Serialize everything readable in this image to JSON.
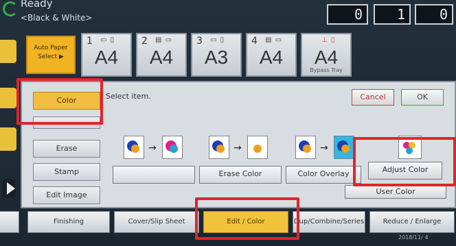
{
  "status": {
    "title": "Ready",
    "mode": "<Black & White>",
    "counter": [
      "0",
      "1",
      "0"
    ]
  },
  "paper": {
    "auto_label": "Auto Paper Select",
    "auto_arrow": "▶",
    "trays": [
      {
        "num": "1",
        "size": "A4"
      },
      {
        "num": "2",
        "size": "A4"
      },
      {
        "num": "3",
        "size": "A3"
      },
      {
        "num": "4",
        "size": "A4"
      },
      {
        "num": "",
        "size": "A4",
        "sub": "Bypass Tray"
      }
    ]
  },
  "dialog": {
    "prompt": "Select item.",
    "cancel": "Cancel",
    "ok": "OK",
    "side_tabs": [
      "Color",
      "",
      "Erase",
      "Stamp",
      "Edit Image"
    ],
    "buttons": {
      "erase_color": "Erase Color",
      "color_overlay": "Color Overlay",
      "adjust_color": "Adjust Color",
      "user_color": "User Color"
    }
  },
  "bottom_tabs": [
    "Finishing",
    "Cover/Slip Sheet",
    "Edit / Color",
    "Dup/Combine/Series",
    "Reduce / Enlarge"
  ],
  "footer": {
    "date": "2018/11/ 4"
  },
  "colors": {
    "accent": "#f0c33a",
    "highlight": "#e0242c"
  }
}
